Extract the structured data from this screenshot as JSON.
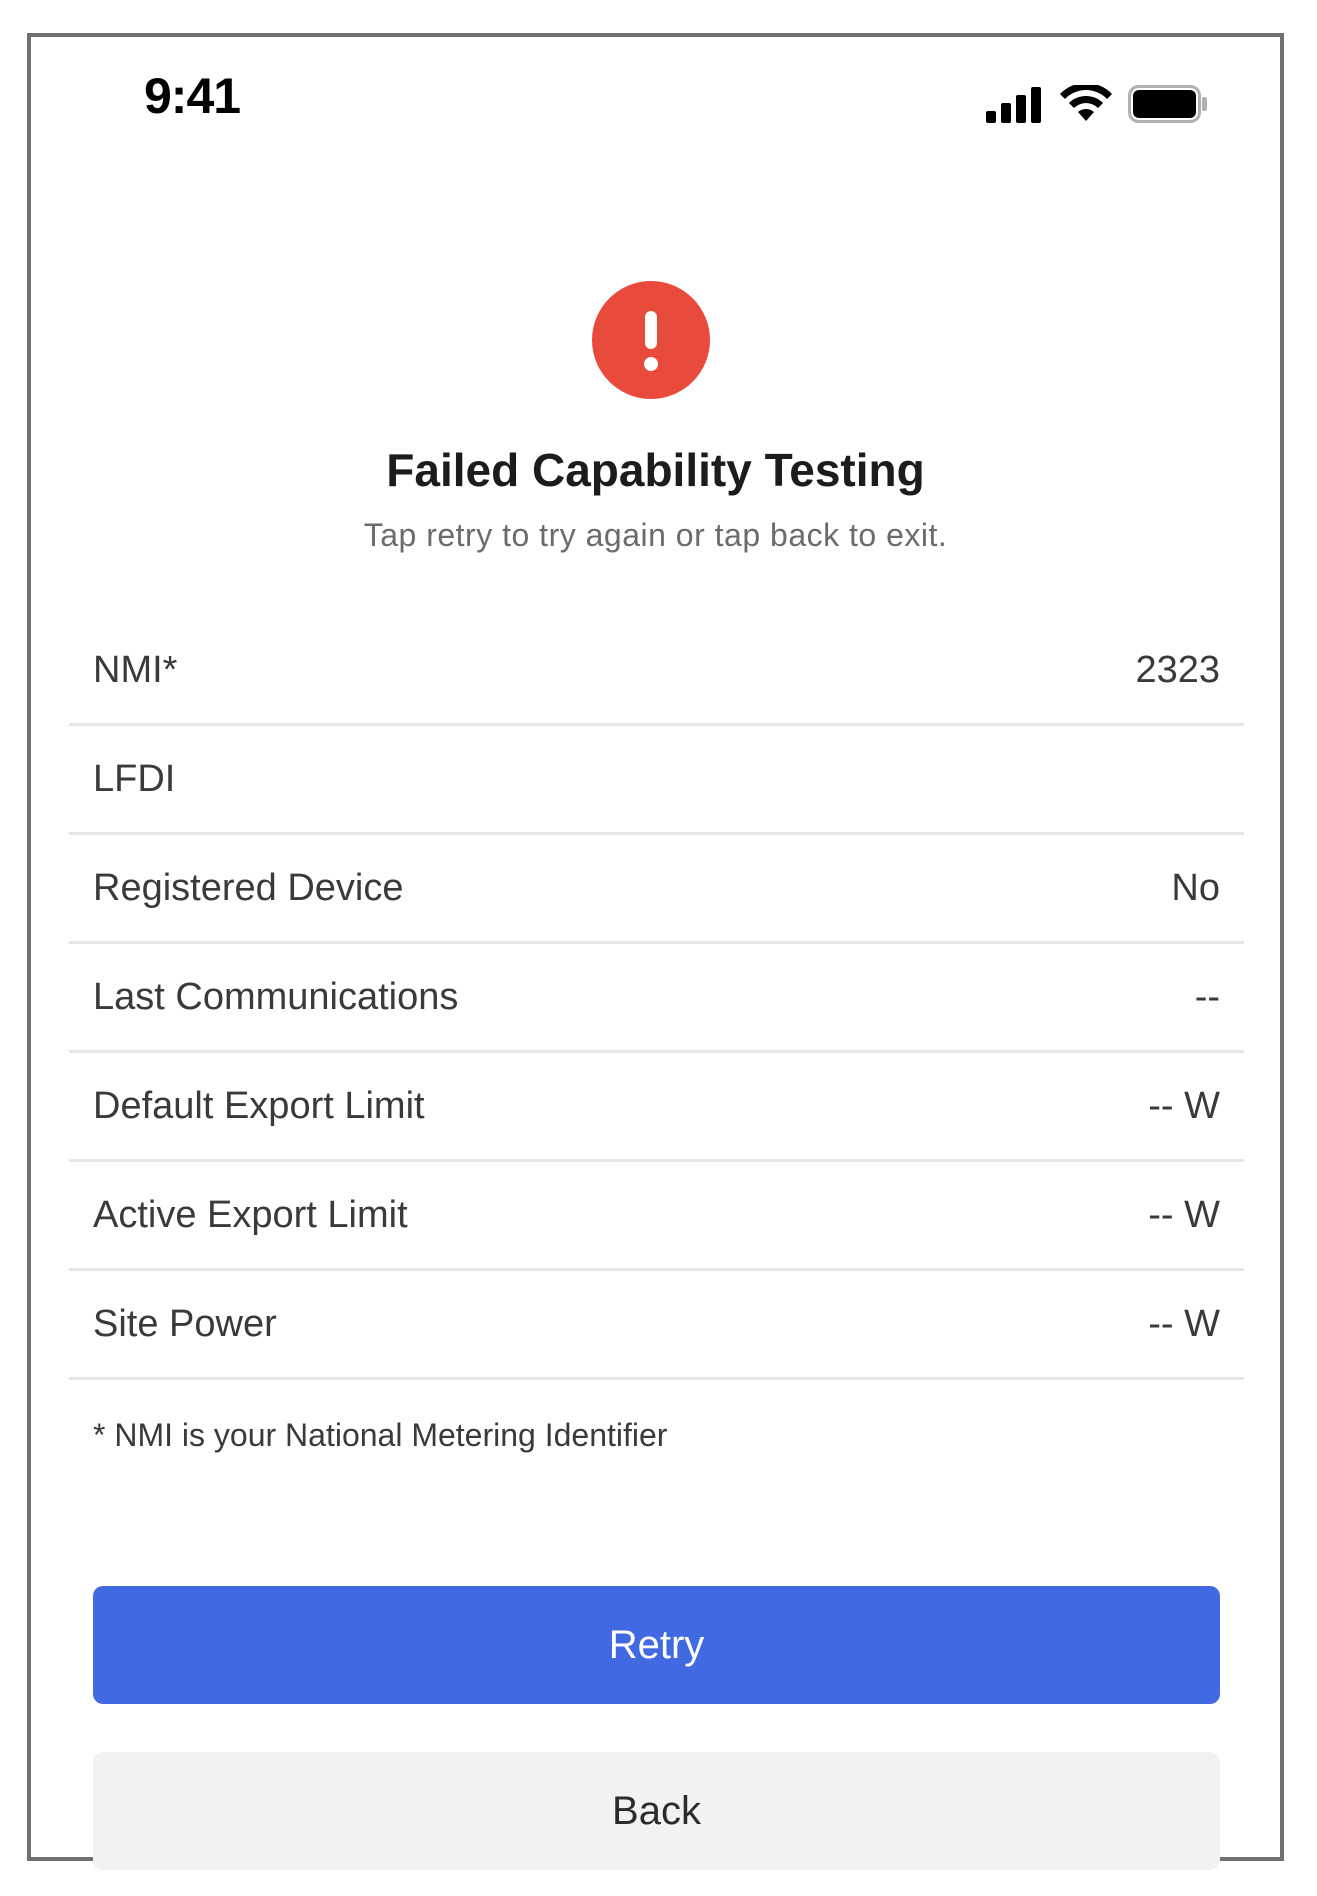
{
  "status_bar": {
    "time": "9:41",
    "icons": [
      "cellular-signal-icon",
      "wifi-icon",
      "battery-icon"
    ]
  },
  "header": {
    "icon": "alert-exclamation-icon",
    "icon_color": "#e84a3b",
    "title": "Failed Capability Testing",
    "subtitle": "Tap retry to try again or tap back to exit."
  },
  "info_rows": [
    {
      "label": "NMI*",
      "value": "2323"
    },
    {
      "label": "LFDI",
      "value": ""
    },
    {
      "label": "Registered Device",
      "value": "No"
    },
    {
      "label": "Last Communications",
      "value": "--"
    },
    {
      "label": "Default Export Limit",
      "value": "-- W"
    },
    {
      "label": "Active Export Limit",
      "value": "-- W"
    },
    {
      "label": "Site Power",
      "value": "-- W"
    }
  ],
  "footnote": "* NMI is your National Metering Identifier",
  "actions": {
    "retry_label": "Retry",
    "back_label": "Back",
    "primary_color": "#4169e1"
  }
}
